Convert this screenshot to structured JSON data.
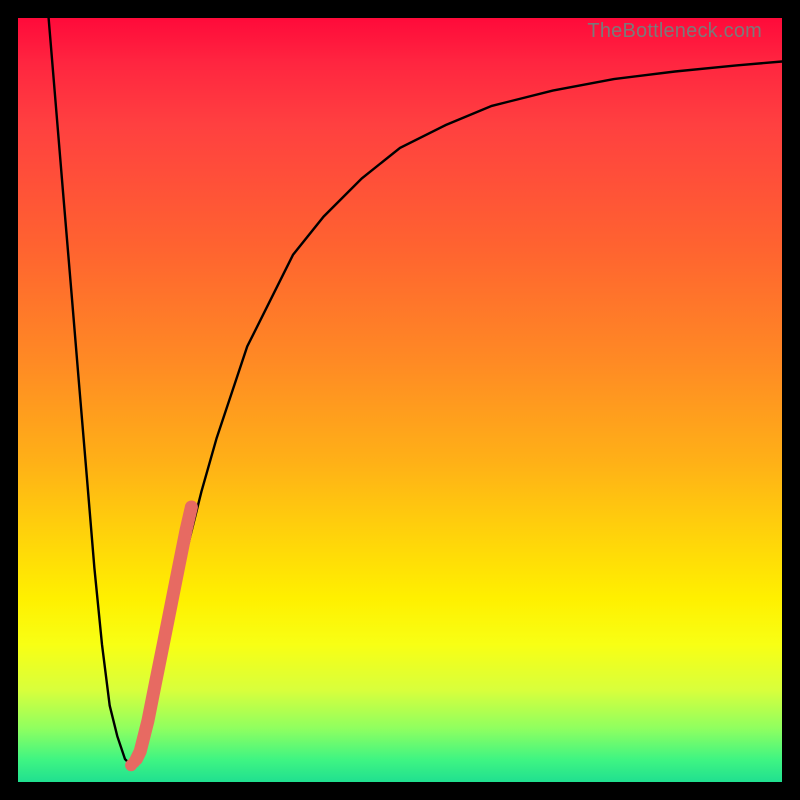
{
  "watermark": "TheBottleneck.com",
  "chart_data": {
    "type": "line",
    "xlabel": "",
    "ylabel": "",
    "xlim": [
      0,
      100
    ],
    "ylim": [
      0,
      100
    ],
    "title": "",
    "series": [
      {
        "name": "curve",
        "color": "#000000",
        "x": [
          4,
          5,
          6,
          7,
          8,
          9,
          10,
          11,
          12,
          13,
          14,
          15,
          16,
          17,
          18,
          19,
          20,
          21,
          22,
          24,
          26,
          28,
          30,
          33,
          36,
          40,
          45,
          50,
          56,
          62,
          70,
          78,
          86,
          94,
          100
        ],
        "y": [
          100,
          88,
          76,
          64,
          52,
          40,
          28,
          18,
          10,
          6,
          3,
          2,
          3,
          6,
          10,
          15,
          20,
          25,
          30,
          38,
          45,
          51,
          57,
          63,
          69,
          74,
          79,
          83,
          86,
          88.5,
          90.5,
          92,
          93,
          93.8,
          94.3
        ]
      },
      {
        "name": "highlight-segment",
        "color": "#e76a62",
        "style": "thick",
        "x": [
          15.5,
          16,
          17,
          18,
          19,
          20,
          21,
          22,
          22.7
        ],
        "y": [
          3,
          4,
          8,
          13,
          18,
          23,
          28,
          33,
          36
        ]
      },
      {
        "name": "highlight-dots",
        "color": "#e76a62",
        "style": "dots",
        "x": [
          14.8,
          15.2
        ],
        "y": [
          2.2,
          2.6
        ]
      }
    ]
  }
}
